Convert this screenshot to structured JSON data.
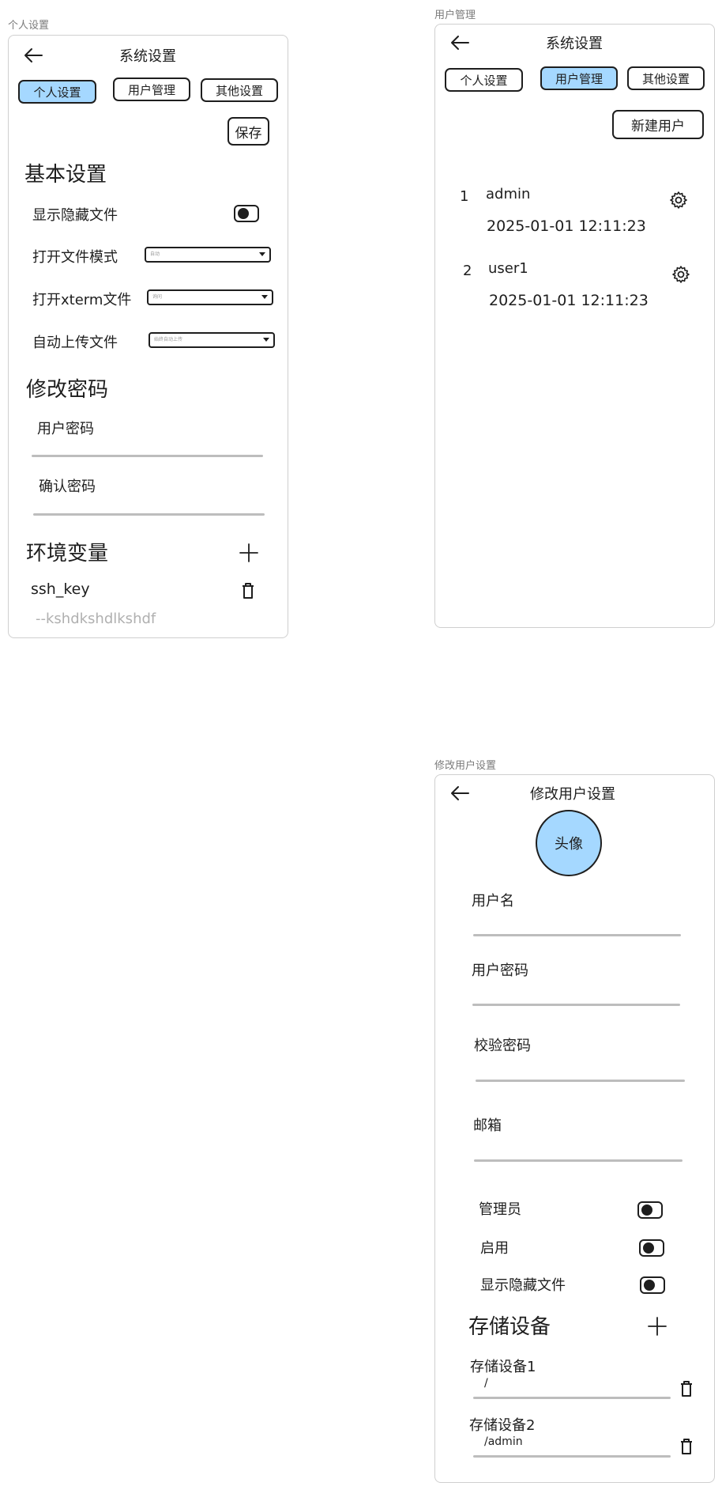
{
  "frames": {
    "personal": {
      "label": "个人设置",
      "title": "系统设置",
      "tabs": [
        {
          "label": "个人设置",
          "active": true
        },
        {
          "label": "用户管理",
          "active": false
        },
        {
          "label": "其他设置",
          "active": false
        }
      ],
      "save_label": "保存",
      "basic_heading": "基本设置",
      "show_hidden_label": "显示隐藏文件",
      "open_mode_label": "打开文件模式",
      "open_mode_value": "自动",
      "open_xterm_label": "打开xterm文件",
      "open_xterm_value": "询问",
      "auto_upload_label": "自动上传文件",
      "auto_upload_value": "始终自动上传",
      "password_heading": "修改密码",
      "user_password_label": "用户密码",
      "confirm_password_label": "确认密码",
      "env_heading": "环境变量",
      "env_items": [
        {
          "name": "ssh_key",
          "value": "--kshdkshdlkshdf"
        }
      ]
    },
    "users": {
      "label": "用户管理",
      "title": "系统设置",
      "tabs": [
        {
          "label": "个人设置",
          "active": false
        },
        {
          "label": "用户管理",
          "active": true
        },
        {
          "label": "其他设置",
          "active": false
        }
      ],
      "new_user_label": "新建用户",
      "users": [
        {
          "index": "1",
          "name": "admin",
          "date": "2025-01-01 12:11:23"
        },
        {
          "index": "2",
          "name": "user1",
          "date": "2025-01-01 12:11:23"
        }
      ]
    },
    "edit_user": {
      "label": "修改用户设置",
      "title": "修改用户设置",
      "avatar_label": "头像",
      "username_label": "用户名",
      "password_label": "用户密码",
      "verify_password_label": "校验密码",
      "email_label": "邮箱",
      "admin_label": "管理员",
      "enabled_label": "启用",
      "show_hidden_label": "显示隐藏文件",
      "storage_heading": "存储设备",
      "storage_items": [
        {
          "name": "存储设备1",
          "path": "/"
        },
        {
          "name": "存储设备2",
          "path": "/admin"
        }
      ]
    }
  },
  "colors": {
    "accent": "#a5d8ff",
    "stroke": "#1e1e1e",
    "frame_border": "#cfcfcf",
    "field_line": "#bdbdbd",
    "muted_text": "#b0b0b0"
  }
}
